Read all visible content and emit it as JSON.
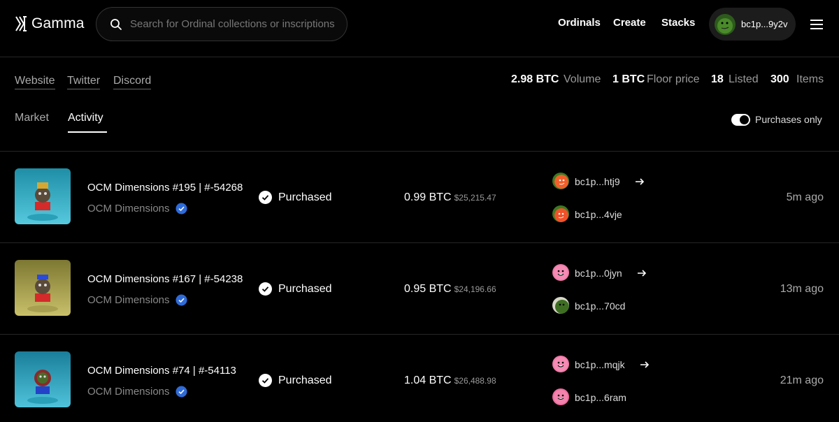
{
  "header": {
    "logo_text": "Gamma",
    "search_placeholder": "Search for Ordinal collections or inscriptions",
    "nav": [
      "Ordinals",
      "Create",
      "Stacks"
    ],
    "wallet_address": "bc1p...9y2v"
  },
  "collection": {
    "links": [
      "Website",
      "Twitter",
      "Discord"
    ],
    "stats": [
      {
        "value": "2.98 BTC",
        "label": "Volume"
      },
      {
        "value": "1 BTC",
        "label": "Floor price"
      },
      {
        "value": "18",
        "label": "Listed"
      },
      {
        "value": "300",
        "label": "Items"
      }
    ]
  },
  "tabs": [
    {
      "label": "Market",
      "active": false
    },
    {
      "label": "Activity",
      "active": true
    }
  ],
  "filter": {
    "label": "Purchases only",
    "enabled": true
  },
  "activity": [
    {
      "name": "OCM Dimensions #195 | #-54268",
      "collection": "OCM Dimensions",
      "status": "Purchased",
      "price": "0.99 BTC",
      "usd": "$25,215.47",
      "from": "bc1p...htj9",
      "to": "bc1p...4vje",
      "time": "5m ago"
    },
    {
      "name": "OCM Dimensions #167 | #-54238",
      "collection": "OCM Dimensions",
      "status": "Purchased",
      "price": "0.95 BTC",
      "usd": "$24,196.66",
      "from": "bc1p...0jyn",
      "to": "bc1p...70cd",
      "time": "13m ago"
    },
    {
      "name": "OCM Dimensions #74 | #-54113",
      "collection": "OCM Dimensions",
      "status": "Purchased",
      "price": "1.04 BTC",
      "usd": "$26,488.98",
      "from": "bc1p...mqjk",
      "to": "bc1p...6ram",
      "time": "21m ago"
    }
  ]
}
